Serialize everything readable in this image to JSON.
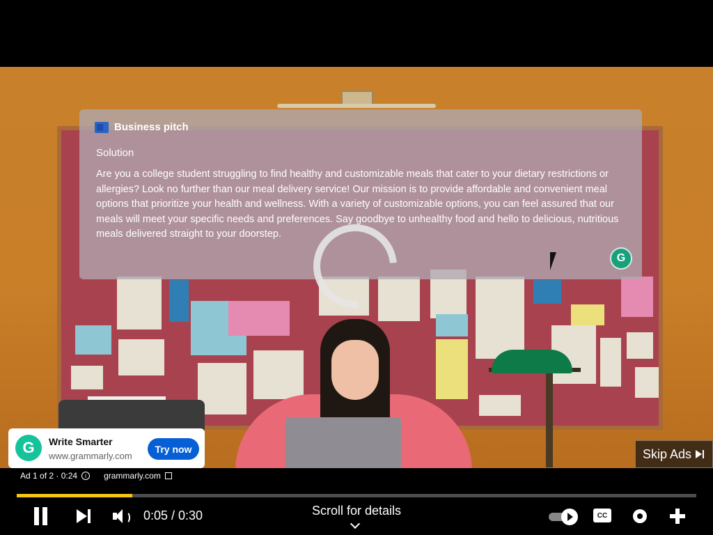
{
  "video": {
    "doc_title": "Business pitch",
    "doc_heading": "Solution",
    "doc_body": "Are you a college student struggling to find healthy and customizable meals that cater to your dietary restrictions or allergies? Look no further than our meal delivery service! Our mission is to provide affordable and convenient meal options that prioritize your health and wellness. With a variety of customizable options, you can feel assured that our meals will meet your specific needs and preferences. Say goodbye to unhealthy food and hello to delicious, nutritious meals delivered straight to your doorstep.",
    "grammarly_badge": "G",
    "icons": [
      "word-icon",
      "grammarly-icon",
      "loading-spinner",
      "mouse-cursor"
    ]
  },
  "ad": {
    "logo_letter": "G",
    "title": "Write Smarter",
    "domain": "www.grammarly.com",
    "cta": "Try now",
    "info": "Ad 1 of 2 · 0:24",
    "advertiser_link": "grammarly.com",
    "skip_label": "Skip Ads"
  },
  "player": {
    "progress_fraction": 0.17,
    "time": "0:05 / 0:30",
    "scroll_label": "Scroll for details",
    "cc_label": "CC",
    "accent_color": "#f6c514",
    "cta_color": "#065fd4",
    "autoplay_on": true
  }
}
